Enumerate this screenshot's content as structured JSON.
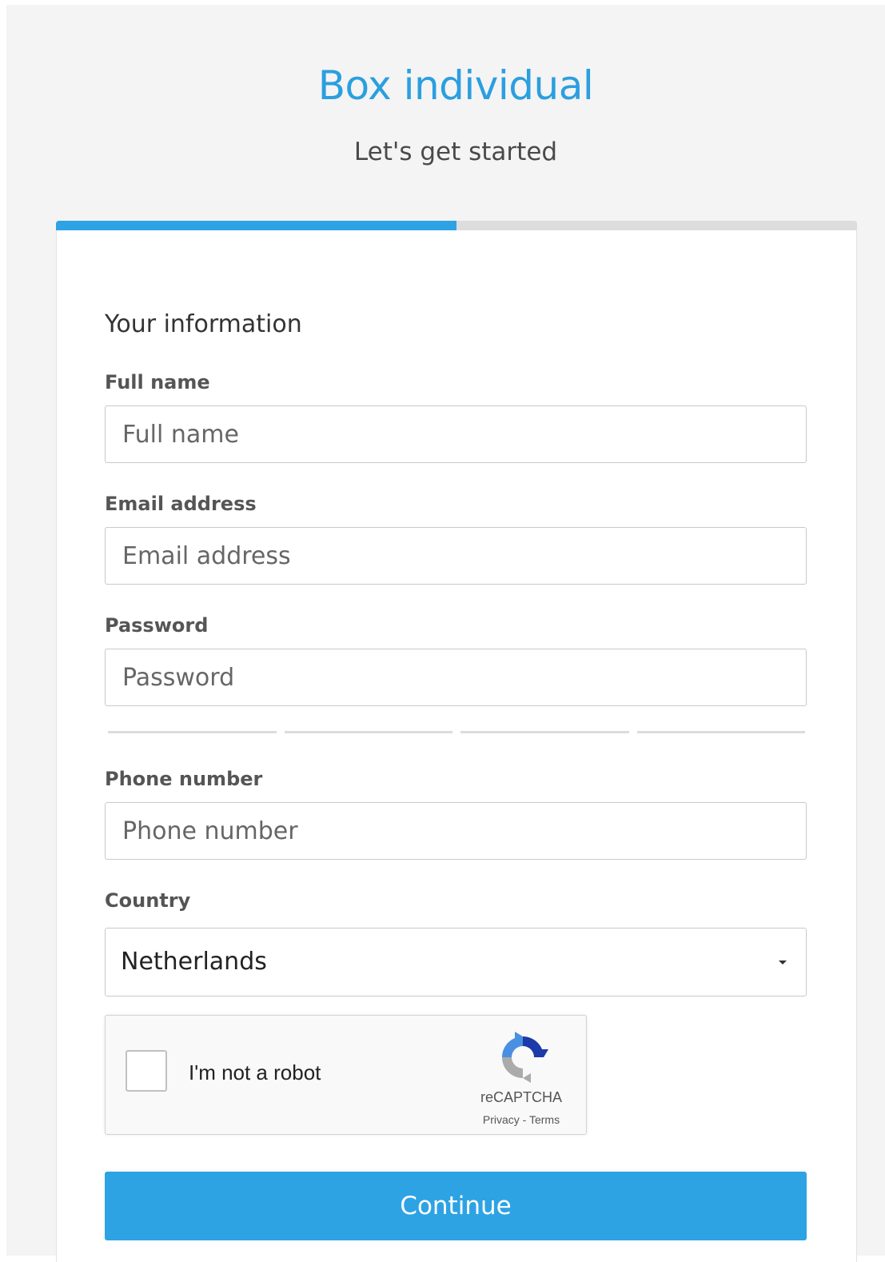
{
  "header": {
    "title": "Box individual",
    "subtitle": "Let's get started"
  },
  "progress": {
    "fraction": 0.5,
    "fill_color": "#2da3e4",
    "track_color": "#dddddd"
  },
  "form": {
    "section_title": "Your information",
    "full_name": {
      "label": "Full name",
      "placeholder": "Full name",
      "value": ""
    },
    "email": {
      "label": "Email address",
      "placeholder": "Email address",
      "value": ""
    },
    "password": {
      "label": "Password",
      "placeholder": "Password",
      "value": ""
    },
    "password_strength_segments": 4,
    "phone": {
      "label": "Phone number",
      "placeholder": "Phone number",
      "value": ""
    },
    "country": {
      "label": "Country",
      "selected": "Netherlands"
    }
  },
  "recaptcha": {
    "label": "I'm not a robot",
    "brand": "reCAPTCHA",
    "privacy": "Privacy",
    "separator": " - ",
    "terms": "Terms",
    "icon": "recaptcha-logo-icon"
  },
  "actions": {
    "continue_label": "Continue"
  },
  "colors": {
    "accent": "#2da3e4",
    "title": "#2b9fdf",
    "background": "#f4f4f4"
  }
}
